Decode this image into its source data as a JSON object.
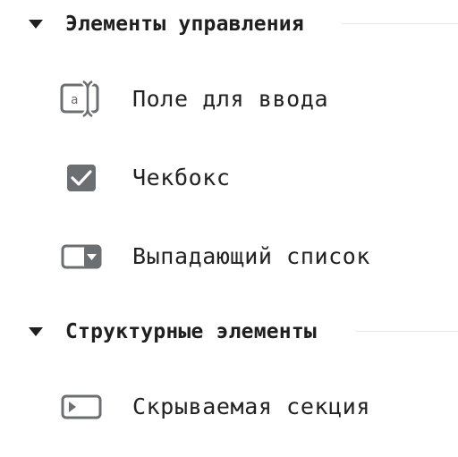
{
  "colors": {
    "icon": "#6b6f72",
    "text": "#222222",
    "rule": "#e6e6e6"
  },
  "sections": [
    {
      "title": "Элементы управления",
      "expanded": true,
      "items": [
        {
          "label": "Поле для ввода",
          "icon": "text-field-icon"
        },
        {
          "label": "Чекбокс",
          "icon": "checkbox-icon"
        },
        {
          "label": "Выпадающий список",
          "icon": "dropdown-icon"
        }
      ]
    },
    {
      "title": "Структурные элементы",
      "expanded": true,
      "items": [
        {
          "label": "Скрываемая секция",
          "icon": "collapsible-section-icon"
        }
      ]
    }
  ]
}
